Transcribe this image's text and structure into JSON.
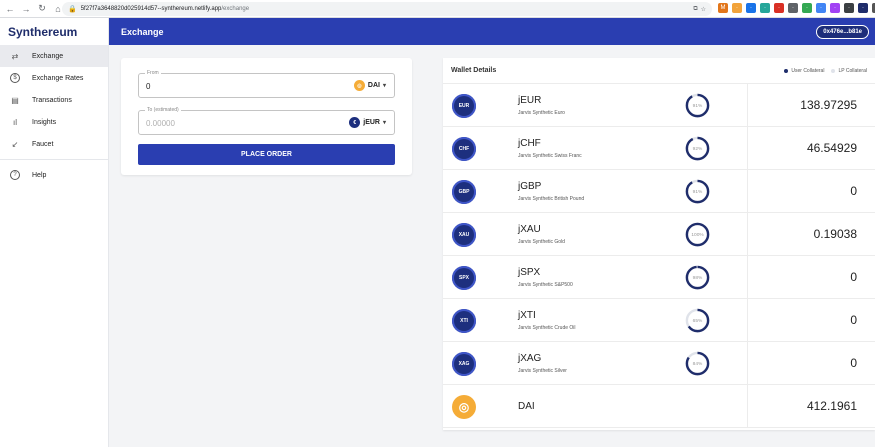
{
  "browser": {
    "url_host": "5f27f7a3648820d025914d57--synthereum.netlify.app",
    "url_path": "/exchange"
  },
  "app": {
    "brand": "Synthereum",
    "page_title": "Exchange",
    "wallet_address": "0x476e...b81e"
  },
  "sidebar": {
    "items": [
      {
        "label": "Exchange",
        "icon": "swap-icon",
        "glyph": "⇄"
      },
      {
        "label": "Exchange Rates",
        "icon": "dollar-circle-icon",
        "glyph": "$"
      },
      {
        "label": "Transactions",
        "icon": "list-icon",
        "glyph": "▤"
      },
      {
        "label": "Insights",
        "icon": "bar-chart-icon",
        "glyph": "ıl"
      },
      {
        "label": "Faucet",
        "icon": "arrow-down-left-icon",
        "glyph": "↙"
      }
    ],
    "help": {
      "label": "Help",
      "icon": "help-circle-icon",
      "glyph": "?"
    }
  },
  "order": {
    "from_label": "From",
    "from_value": "0",
    "from_token": "DAI",
    "to_label": "To (estimated)",
    "to_placeholder": "0.00000",
    "to_token": "jEUR",
    "submit_label": "PLACE ORDER"
  },
  "wallet": {
    "title": "Wallet Details",
    "legend_user": "User Collateral",
    "legend_lp": "LP Collateral",
    "rows": [
      {
        "logo_text": "EUR",
        "symbol": "jEUR",
        "name": "Jarvis Synthetic Euro",
        "pct": "91%",
        "pct_value": 91,
        "balance": "138.97295"
      },
      {
        "logo_text": "CHF",
        "symbol": "jCHF",
        "name": "Jarvis Synthetic Swiss Franc",
        "pct": "92%",
        "pct_value": 92,
        "balance": "46.54929"
      },
      {
        "logo_text": "GBP",
        "symbol": "jGBP",
        "name": "Jarvis Synthetic British Pound",
        "pct": "91%",
        "pct_value": 91,
        "balance": "0"
      },
      {
        "logo_text": "XAU",
        "symbol": "jXAU",
        "name": "Jarvis Synthetic Gold",
        "pct": "100%",
        "pct_value": 100,
        "balance": "0.19038"
      },
      {
        "logo_text": "SPX",
        "symbol": "jSPX",
        "name": "Jarvis Synthetic S&P500",
        "pct": "98%",
        "pct_value": 98,
        "balance": "0"
      },
      {
        "logo_text": "XTI",
        "symbol": "jXTI",
        "name": "Jarvis Synthetic Crude Oil",
        "pct": "65%",
        "pct_value": 65,
        "balance": "0"
      },
      {
        "logo_text": "XAG",
        "symbol": "jXAG",
        "name": "Jarvis Synthetic Silver",
        "pct": "84%",
        "pct_value": 84,
        "balance": "0"
      },
      {
        "logo_text": "",
        "symbol": "DAI",
        "name": "",
        "pct": "",
        "pct_value": null,
        "balance": "412.1961"
      }
    ]
  },
  "colors": {
    "primary": "#2a3eb1",
    "brand_text": "#1f2d6b",
    "dai": "#f5ac37",
    "token_logo": "#1d2f7e",
    "ring_user": "#1f2d6b",
    "ring_lp": "#e0e3ea"
  }
}
